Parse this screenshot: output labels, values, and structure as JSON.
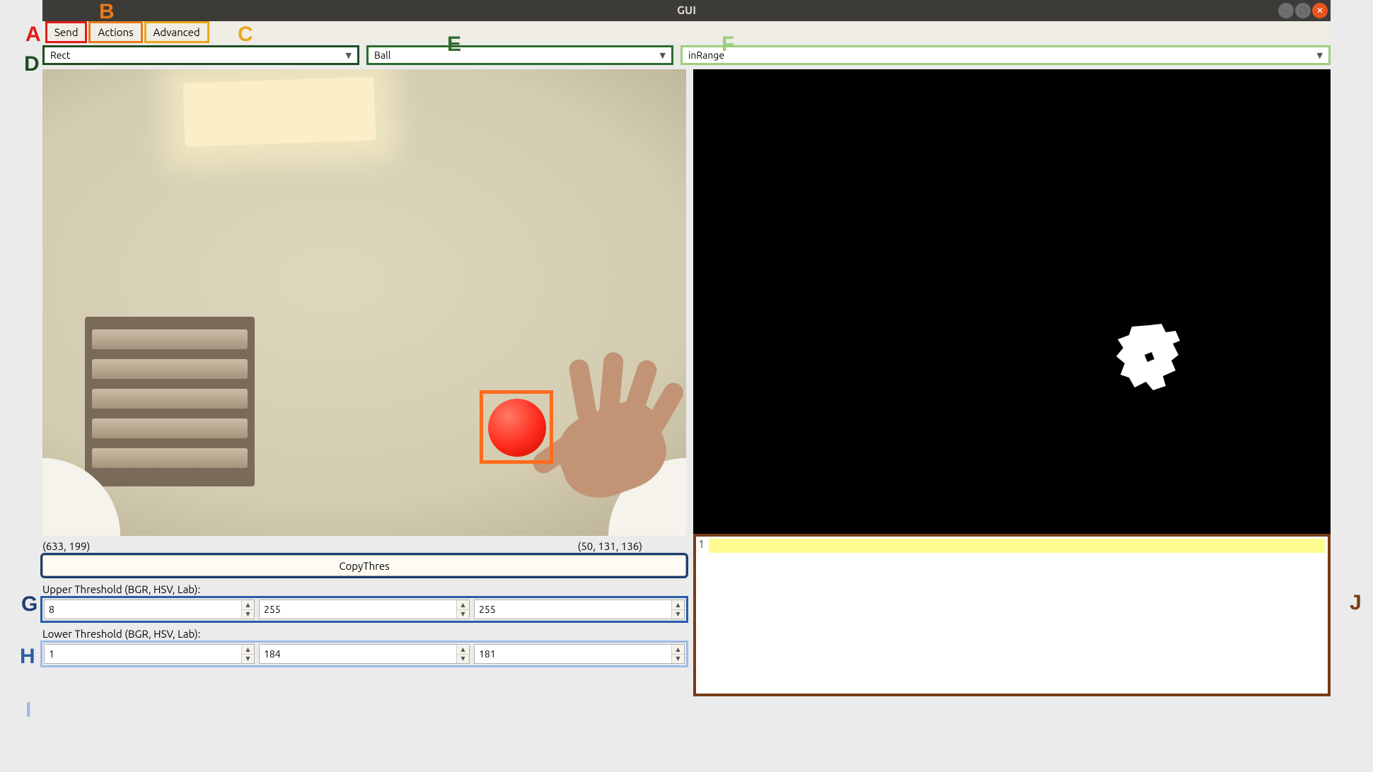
{
  "window": {
    "title": "GUI"
  },
  "menu": {
    "send": "Send",
    "actions": "Actions",
    "advanced": "Advanced"
  },
  "dropdowns": {
    "shape": "Rect",
    "object": "Ball",
    "method": "inRange"
  },
  "status": {
    "coords": "(633, 199)",
    "color": "(50, 131, 136)"
  },
  "controls": {
    "copy_thres": "CopyThres",
    "upper_label": "Upper Threshold (BGR, HSV, Lab):",
    "lower_label": "Lower Threshold (BGR, HSV, Lab):",
    "upper": {
      "a": "8",
      "b": "255",
      "c": "255"
    },
    "lower": {
      "a": "1",
      "b": "184",
      "c": "181"
    }
  },
  "right_panel": {
    "line_no": "1"
  },
  "annotations": {
    "A": "A",
    "B": "B",
    "C": "C",
    "D": "D",
    "E": "E",
    "F": "F",
    "G": "G",
    "H": "H",
    "I": "I",
    "J": "J"
  },
  "annotation_colors": {
    "A": "#e21b1b",
    "B": "#e87a1a",
    "C": "#e8a81a",
    "D": "#1e4d22",
    "E": "#2e6b2e",
    "F": "#9bcf7a",
    "G": "#1b3e6e",
    "H": "#2a5da8",
    "I": "#9dbbe6",
    "J": "#773c18"
  }
}
